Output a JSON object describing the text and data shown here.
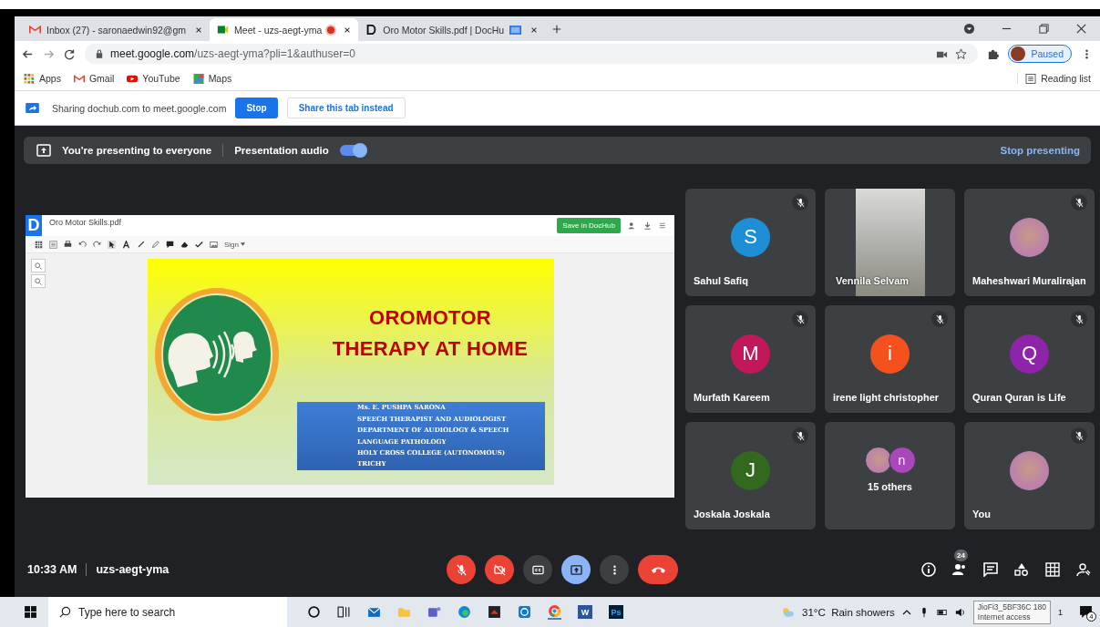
{
  "browser": {
    "tabs": [
      {
        "title": "Inbox (27) - saronaedwin92@gm",
        "selected": false,
        "recording": false,
        "sharing": false
      },
      {
        "title": "Meet - uzs-aegt-yma",
        "selected": true,
        "recording": true,
        "sharing": false
      },
      {
        "title": "Oro Motor Skills.pdf | DocHu",
        "selected": false,
        "recording": false,
        "sharing": true
      }
    ],
    "url_host": "meet.google.com",
    "url_path": "/uzs-aegt-yma?pli=1&authuser=0",
    "profile": "Paused",
    "bookmarks": [
      {
        "label": "Apps"
      },
      {
        "label": "Gmail"
      },
      {
        "label": "YouTube"
      },
      {
        "label": "Maps"
      }
    ],
    "reading_list": "Reading list"
  },
  "share_bar": {
    "message": "Sharing dochub.com to meet.google.com",
    "stop": "Stop",
    "share_tab": "Share this tab instead"
  },
  "presenting_bar": {
    "message": "You're presenting to everyone",
    "audio_label": "Presentation audio",
    "audio_on": true,
    "stop": "Stop presenting"
  },
  "document": {
    "logo": "D",
    "filename": "Oro Motor Skills.pdf",
    "save": "Save in DocHub",
    "sign": "Sign",
    "title_lines": [
      "OROMOTOR",
      "THERAPY AT HOME"
    ],
    "author_lines": [
      "Ms. E. PUSHPA SARONA",
      "SPEECH THERAPIST AND AUDIOLOGIST",
      "DEPARTMENT OF AUDIOLOGY & SPEECH",
      "LANGUAGE PATHOLOGY",
      "HOLY CROSS COLLEGE (AUTONOMOUS)",
      "TRICHY"
    ]
  },
  "participants": [
    {
      "name": "Sahul Safiq",
      "kind": "letter",
      "letter": "S",
      "color": "#1e8fd6",
      "muted": true
    },
    {
      "name": "Vennila Selvam",
      "kind": "video",
      "muted": false
    },
    {
      "name": "Maheshwari Muralirajan",
      "kind": "photo",
      "muted": true
    },
    {
      "name": "Murfath Kareem",
      "kind": "letter",
      "letter": "M",
      "color": "#c2185b",
      "muted": true
    },
    {
      "name": "irene light christopher",
      "kind": "letter",
      "letter": "i",
      "color": "#f4511e",
      "muted": true
    },
    {
      "name": "Quran Quran is Life",
      "kind": "letter",
      "letter": "Q",
      "color": "#8e24aa",
      "muted": true
    },
    {
      "name": "Joskala Joskala",
      "kind": "letter",
      "letter": "J",
      "color": "#33691e",
      "muted": true
    },
    {
      "name": "15 others",
      "kind": "group",
      "letter": "n",
      "color": "#ab47bc",
      "muted": false
    },
    {
      "name": "You",
      "kind": "photo",
      "muted": true
    }
  ],
  "footer": {
    "time": "10:33 AM",
    "code": "uzs-aegt-yma",
    "people_count": "24",
    "controls": [
      {
        "kind": "mic",
        "off": true
      },
      {
        "kind": "camera",
        "off": true
      },
      {
        "kind": "captions",
        "off": false
      },
      {
        "kind": "present",
        "off": false,
        "selected": true
      },
      {
        "kind": "more",
        "off": false
      },
      {
        "kind": "hangup",
        "off": true
      }
    ]
  },
  "taskbar": {
    "search_placeholder": "Type here to search",
    "word": "W",
    "photoshop": "Ps",
    "weather": "31°C  Rain showers",
    "tooltip_lines": [
      "JioFi3_5BF36C 180",
      "Internet access"
    ],
    "clock_fragment": "1",
    "notifications": "4"
  }
}
